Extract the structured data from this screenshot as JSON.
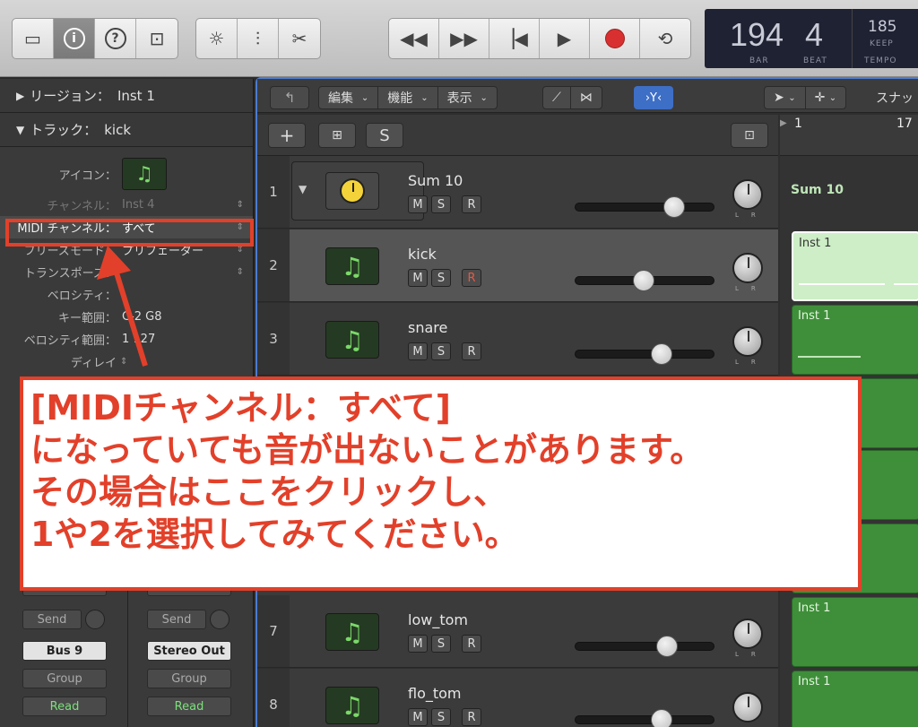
{
  "toolbar": {
    "view_buttons": [
      "inbox-icon",
      "info-icon",
      "help-icon",
      "dropdown-panel-icon"
    ],
    "edit_buttons": [
      "tuner-icon",
      "mixer-icon",
      "scissors-icon"
    ],
    "transport": [
      "rewind-icon",
      "fast-forward-icon",
      "go-to-start-icon",
      "play-icon",
      "record-icon",
      "cycle-icon"
    ]
  },
  "lcd": {
    "bar": "194",
    "beat": "4",
    "bar_label": "BAR",
    "beat_label": "BEAT",
    "tempo": "185",
    "keep": "KEEP",
    "tempo_label": "TEMPO"
  },
  "inspector": {
    "region_label": "リージョン：",
    "region_value": "Inst 1",
    "track_label": "トラック：",
    "track_value": "kick",
    "icon_label": "アイコン：",
    "channel_label": "チャンネル：",
    "channel_value": "Inst 4",
    "midi_label": "MIDI チャンネル：",
    "midi_value": "すべて",
    "freeze_label": "フリーズモード：",
    "freeze_value": "プリフェーダー",
    "transpose_label": "トランスポーズ：",
    "velocity_label": "ベロシティ：",
    "key_range_label": "キー範囲：",
    "key_range_value": "C-2  G8",
    "vel_range_label": "ベロシティ範囲：",
    "vel_range_value": "1  127",
    "delay_label": "ディレイ",
    "strip_left": {
      "send": "Send",
      "output": "Bus 9",
      "group": "Group",
      "automation": "Read"
    },
    "strip_right": {
      "send": "Send",
      "output": "Stereo Out",
      "group": "Group",
      "automation": "Read"
    }
  },
  "main": {
    "menus": [
      "編集",
      "機能",
      "表示"
    ],
    "snap_label": "スナッ",
    "ruler": [
      "1",
      "17"
    ],
    "add_label": "+",
    "s_label": "S"
  },
  "tracks": [
    {
      "num": "1",
      "name": "Sum 10",
      "region": "Sum 10"
    },
    {
      "num": "2",
      "name": "kick",
      "region": "Inst 1"
    },
    {
      "num": "3",
      "name": "snare",
      "region": "Inst 1"
    },
    {
      "num": "7",
      "name": "low_tom",
      "region": "Inst 1"
    },
    {
      "num": "8",
      "name": "flo_tom",
      "region": "Inst 1"
    }
  ],
  "msr": [
    "M",
    "S",
    "R"
  ],
  "callout": {
    "line1": "[MIDIチャンネル：すべて]",
    "line2": "になっていても音が出ないことがあります。",
    "line3": "その場合はここをクリックし、",
    "line4": "1や2を選択してみてください。"
  },
  "colors": {
    "accent_red": "#e2402a",
    "region_green": "#3f8f3a",
    "selection_blue": "#4b7bd1"
  }
}
